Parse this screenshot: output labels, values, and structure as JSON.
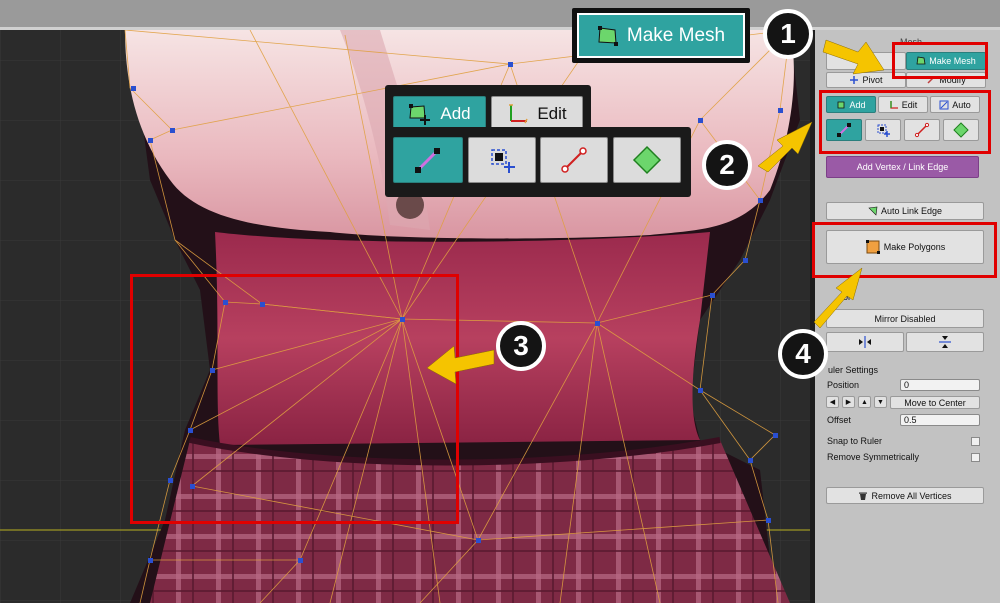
{
  "callouts": {
    "make_mesh": "Make Mesh",
    "add": "Add",
    "edit": "Edit",
    "step1": "1",
    "step2": "2",
    "step3": "3",
    "step4": "4"
  },
  "panel": {
    "header": "Mesh",
    "tab_setting": "ting",
    "tab_make_mesh": "Make Mesh",
    "tab_pivot": "Pivot",
    "tab_modify": "Modify",
    "mode_add": "Add",
    "mode_edit": "Edit",
    "mode_auto": "Auto",
    "add_vertex_link_edge": "Add Vertex / Link Edge",
    "auto_link_edge": "Auto Link Edge",
    "make_polygons": "Make Polygons",
    "mirror_tool_label": "ool",
    "mirror_disabled": "Mirror Disabled",
    "ruler_settings": "uler Settings",
    "position_label": "Position",
    "position_value": "0",
    "move_to_center": "Move to Center",
    "offset_label": "Offset",
    "offset_value": "0.5",
    "snap_to_ruler": "Snap to Ruler",
    "remove_symmetrically": "Remove Symmetrically",
    "remove_all_vertices": "Remove All Vertices"
  },
  "colors": {
    "accent_teal": "#2fa3a0",
    "highlight_red": "#e00000",
    "arrow_yellow": "#f5c400",
    "mesh_edge": "#e0a040",
    "vertex_blue": "#2a4fd0"
  }
}
